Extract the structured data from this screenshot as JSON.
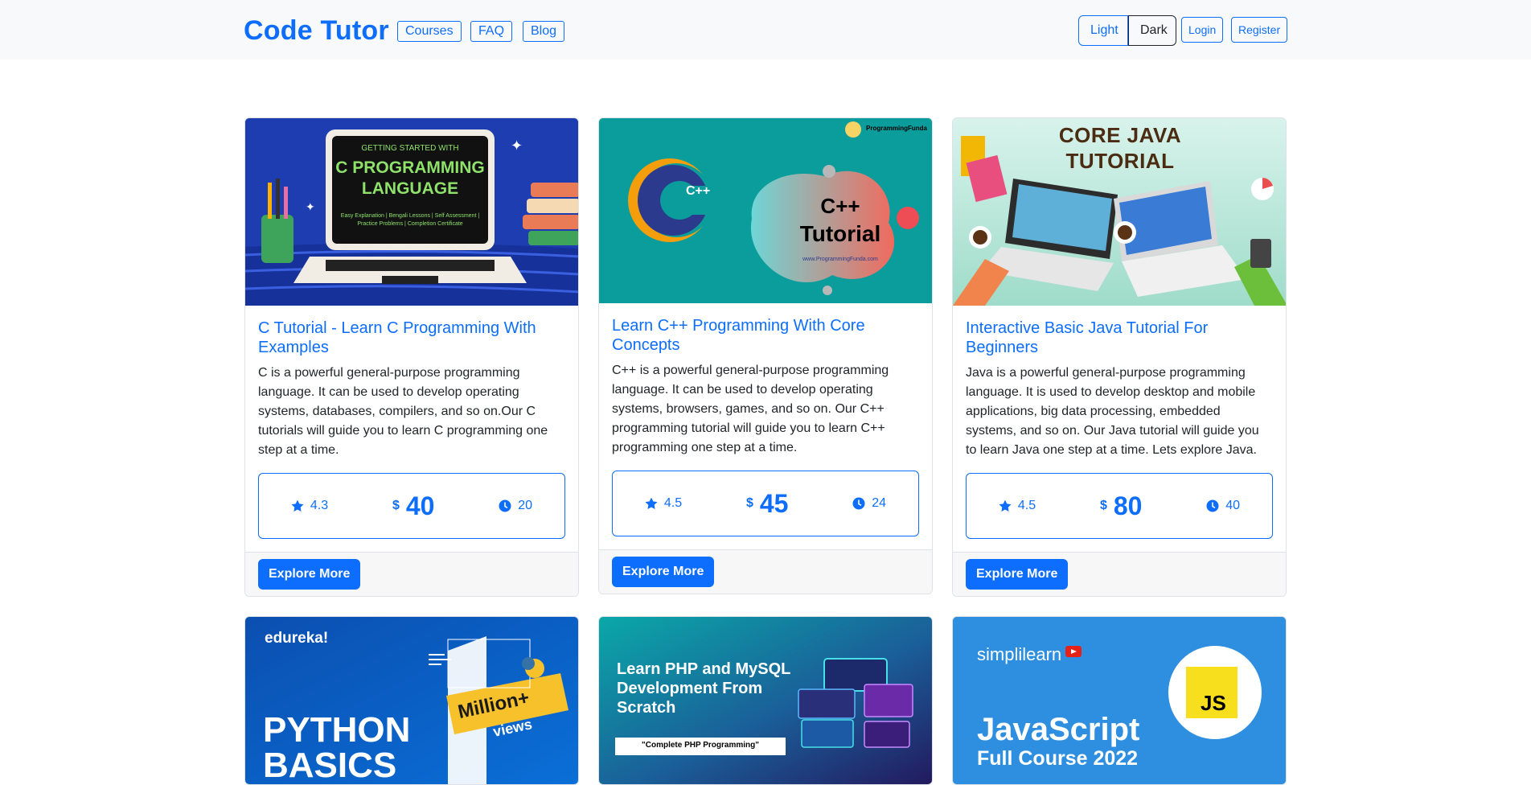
{
  "header": {
    "brand": "Code Tutor",
    "nav": [
      "Courses",
      "FAQ",
      "Blog"
    ],
    "theme": {
      "light": "Light",
      "dark": "Dark",
      "selected": "Dark"
    },
    "login": "Login",
    "register": "Register"
  },
  "cards": [
    {
      "title": "C Tutorial - Learn C Programming With Examples",
      "description": "C is a powerful general-purpose programming language. It can be used to develop operating systems, databases, compilers, and so on.Our C tutorials will guide you to learn C programming one step at a time.",
      "rating": "4.3",
      "currency": "$",
      "price": "40",
      "duration": "20",
      "button": "Explore More",
      "thumb": {
        "line1": "GETTING STARTED WITH",
        "line2": "C PROGRAMMING",
        "line3": "LANGUAGE",
        "line4": "Easy Explanation | Bengali Lessons | Self Assessment |",
        "line5": "Practice Problems | Completion Certificate"
      }
    },
    {
      "title": "Learn C++ Programming With Core Concepts",
      "description": "C++ is a powerful general-purpose programming language. It can be used to develop operating systems, browsers, games, and so on. Our C++ programming tutorial will guide you to learn C++ programming one step at a time.",
      "rating": "4.5",
      "currency": "$",
      "price": "45",
      "duration": "24",
      "button": "Explore More",
      "thumb": {
        "brand": "ProgrammingFunda",
        "logo": "C++",
        "line1": "C++",
        "line2": "Tutorial",
        "url": "www.ProgrammingFunda.com"
      }
    },
    {
      "title": "Interactive Basic Java Tutorial For Beginners",
      "description": "Java is a powerful general-purpose programming language. It is used to develop desktop and mobile applications, big data processing, embedded systems, and so on. Our Java tutorial will guide you to learn Java one step at a time. Lets explore Java.",
      "rating": "4.5",
      "currency": "$",
      "price": "80",
      "duration": "40",
      "button": "Explore More",
      "thumb": {
        "line1": "CORE JAVA",
        "line2": "TUTORIAL"
      }
    }
  ],
  "row2": [
    {
      "brand": "edureka!",
      "line1": "PYTHON",
      "line2": "BASICS",
      "badge1": "Million+",
      "badge2": "views",
      "big": "1"
    },
    {
      "line1": "Learn PHP and MySQL",
      "line2": "Development From",
      "line3": "Scratch",
      "pill": "\"Complete PHP Programming\""
    },
    {
      "brand": "simplilearn",
      "line1": "JavaScript",
      "line2": "Full Course 2022",
      "logo": "JS"
    }
  ]
}
